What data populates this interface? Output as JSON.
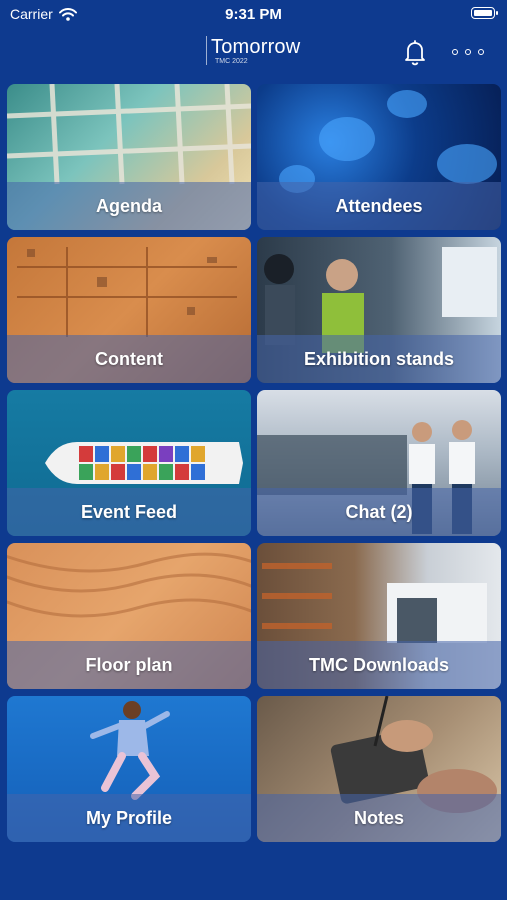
{
  "status_bar": {
    "carrier": "Carrier",
    "time": "9:31 PM"
  },
  "header": {
    "title": "Tomorrow",
    "subtitle": "TMC 2022"
  },
  "tiles": [
    {
      "label": "Agenda"
    },
    {
      "label": "Attendees"
    },
    {
      "label": "Content"
    },
    {
      "label": "Exhibition stands"
    },
    {
      "label": "Event Feed"
    },
    {
      "label": "Chat (2)"
    },
    {
      "label": "Floor plan"
    },
    {
      "label": "TMC Downloads"
    },
    {
      "label": "My Profile"
    },
    {
      "label": "Notes"
    }
  ],
  "colors": {
    "background": "#0e3a8f",
    "tile_band": "#4664aa"
  },
  "icons": [
    "wifi-icon",
    "battery-icon",
    "bell-icon",
    "more-icon"
  ]
}
